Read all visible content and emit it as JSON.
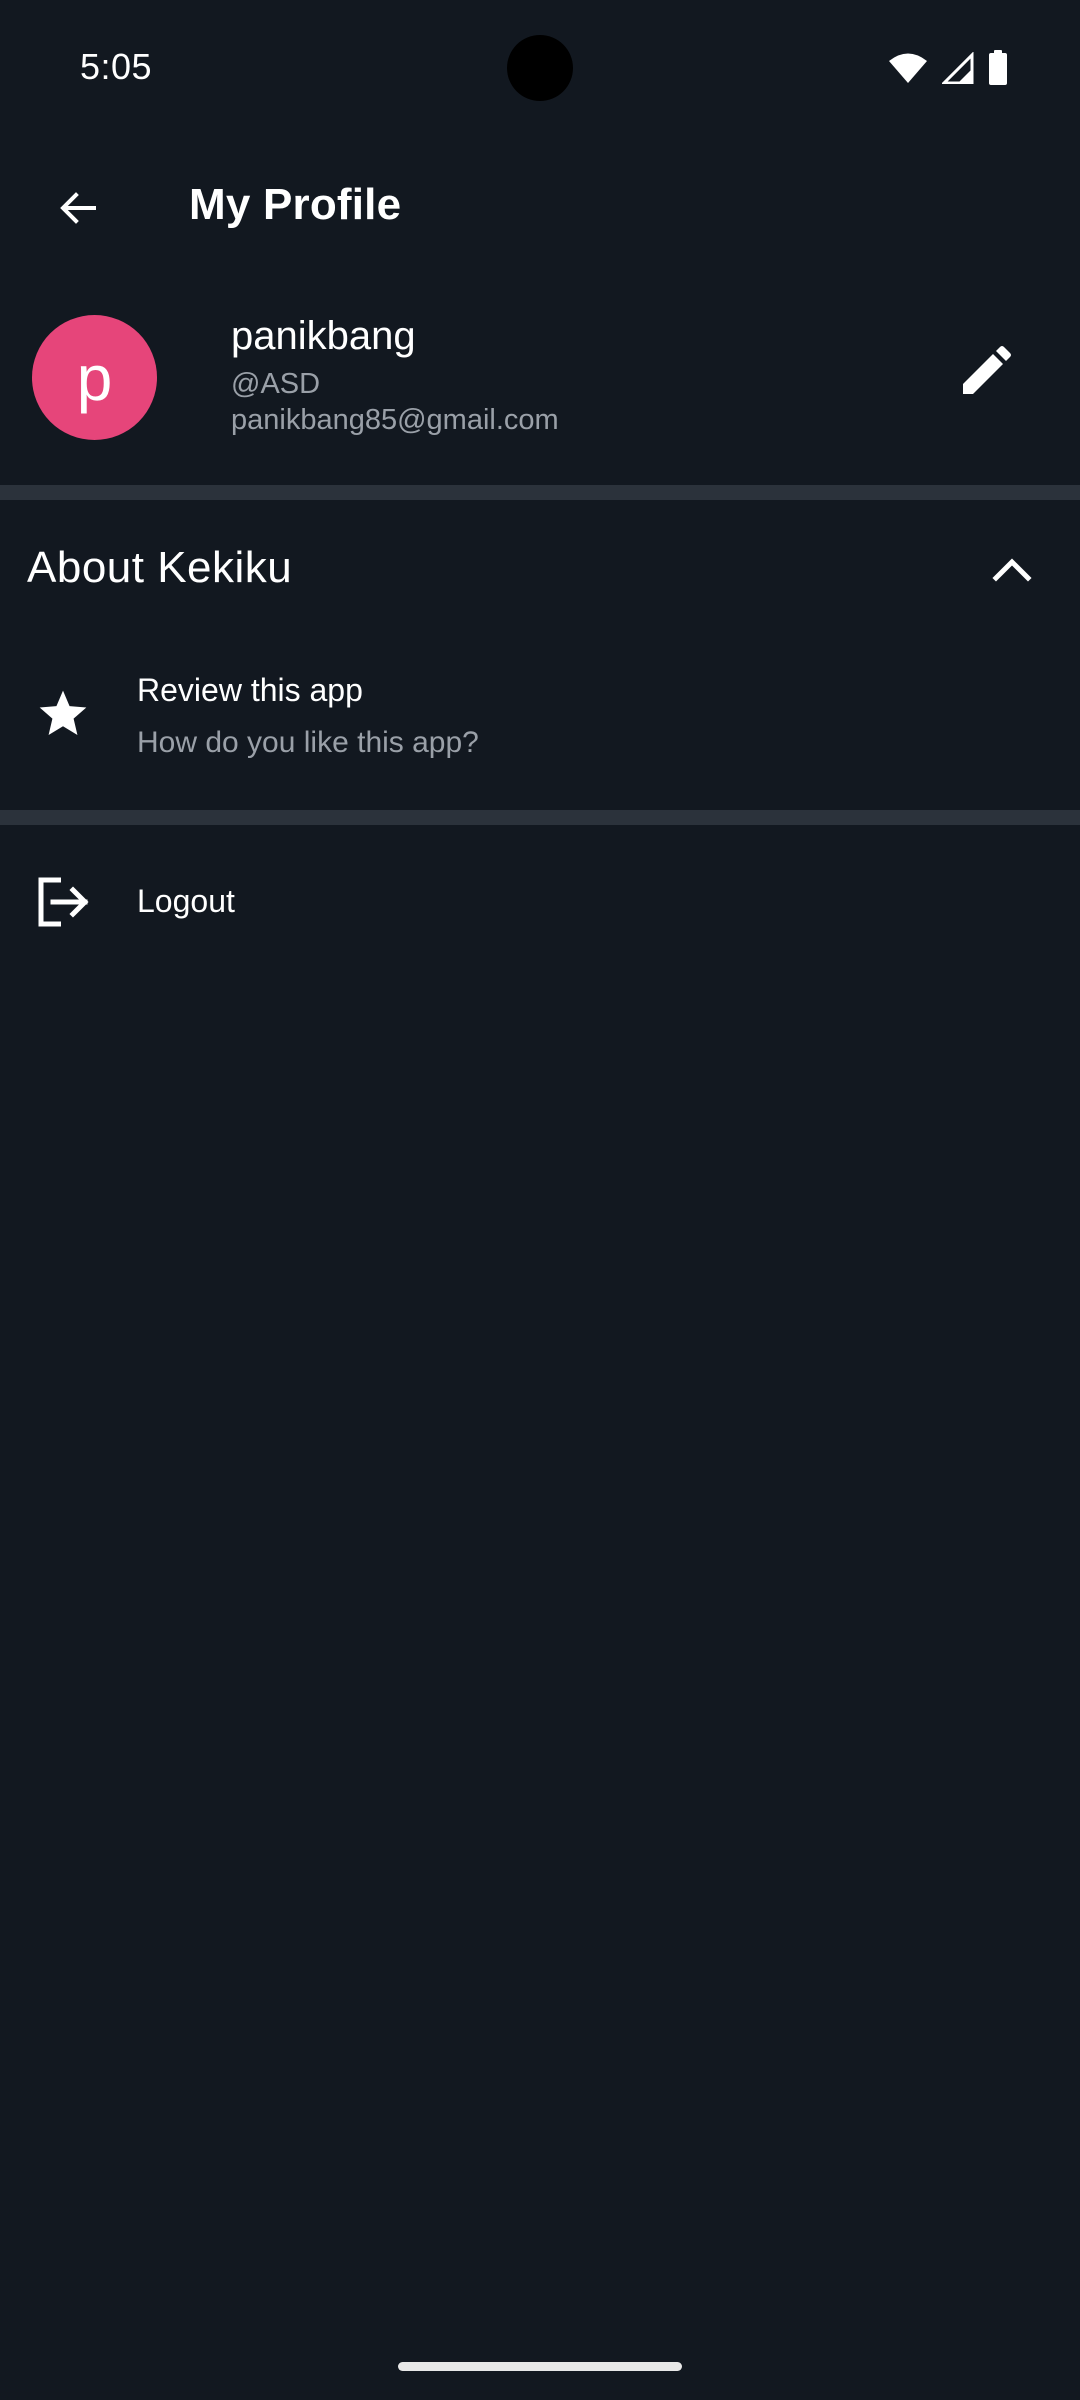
{
  "status_bar": {
    "time": "5:05",
    "icons": [
      "wifi-icon",
      "cell-signal-icon",
      "battery-icon"
    ]
  },
  "app_bar": {
    "back_icon": "arrow-back-icon",
    "title": "My Profile"
  },
  "profile": {
    "avatar_letter": "p",
    "avatar_color": "#e6457a",
    "name": "panikbang",
    "handle": "@ASD",
    "email": "panikbang85@gmail.com",
    "edit_icon": "pencil-icon"
  },
  "about_section": {
    "title": "About Kekiku",
    "toggle_icon": "chevron-up-icon",
    "items": [
      {
        "icon": "star-icon",
        "title": "Review this app",
        "subtitle": "How do you like this app?"
      }
    ]
  },
  "logout": {
    "icon": "logout-icon",
    "label": "Logout"
  },
  "colors": {
    "background": "#121820",
    "divider": "#2b323b",
    "secondary_text": "#9aa0a8"
  }
}
